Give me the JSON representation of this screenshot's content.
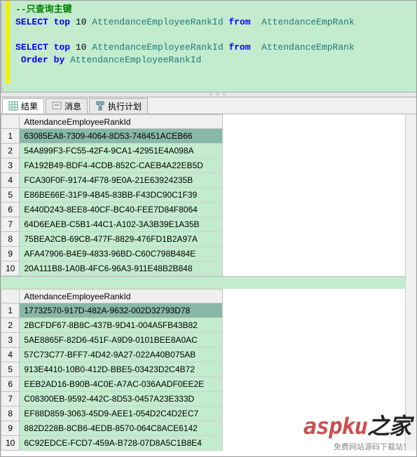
{
  "sql": {
    "comment": "--只查询主键",
    "line1": {
      "kw1": "SELECT",
      "kw2": "top",
      "num": "10",
      "col": "AttendanceEmployeeRankId",
      "kw3": "from",
      "tbl": "AttendanceEmpRank"
    },
    "line2": {
      "kw1": "SELECT",
      "kw2": "top",
      "num": "10",
      "col": "AttendanceEmployeeRankId",
      "kw3": "from",
      "tbl": "AttendanceEmpRank"
    },
    "line3": {
      "kw1": "Order",
      "kw2": "by",
      "col": "AttendanceEmployeeRankId"
    }
  },
  "tabs": {
    "results": "结果",
    "messages": "消息",
    "plan": "执行计划"
  },
  "grid1": {
    "header": "AttendanceEmployeeRankId",
    "rows": [
      "63085EA8-7309-4064-8D53-748451ACEB66",
      "54A899F3-FC55-42F4-9CA1-42951E4A098A",
      "FA192B49-BDF4-4CDB-852C-CAEB4A22EB5D",
      "FCA30F0F-9174-4F78-9E0A-21E63924235B",
      "E86BE66E-31F9-4B45-83BB-F43DC90C1F39",
      "E440D243-8EE8-40CF-BC40-FEE7D84F8064",
      "64D6EAEB-C5B1-44C1-A102-3A3B39E1A35B",
      "75BEA2CB-69CB-477F-8829-476FD1B2A97A",
      "AFA47906-B4E9-4833-96BD-C60C798B484E",
      "20A111B8-1A0B-4FC6-96A3-911E48B2B848"
    ]
  },
  "grid2": {
    "header": "AttendanceEmployeeRankId",
    "rows": [
      "17732570-917D-482A-9632-002D32793D78",
      "2BCFDF67-8B8C-437B-9D41-004A5FB43B82",
      "5AE8865F-82D6-451F-A9D9-0101BEE8A0AC",
      "57C73C77-BFF7-4D42-9A27-022A40B075AB",
      "913E4410-10B0-412D-BBE5-03423D2C4B72",
      "EEB2AD16-B90B-4C0E-A7AC-036AADF0EE2E",
      "C08300EB-9592-442C-8D53-0457A23E333D",
      "EF88D859-3063-45D9-AEE1-054D2C4D2EC7",
      "882D228B-8CB6-4EDB-8570-064C8ACE6142",
      "6C92EDCE-FCD7-459A-B728-07D8A5C1B8E4"
    ]
  },
  "watermark": {
    "brand": "aspku",
    "suffix": "之家",
    "tagline": "免费网站源码下载站！"
  }
}
